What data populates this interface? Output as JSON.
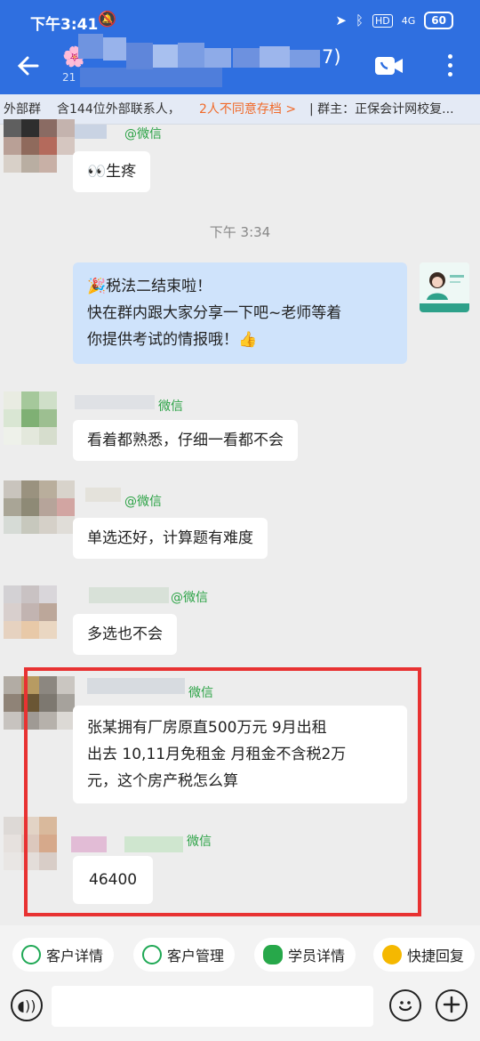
{
  "status": {
    "time": "下午3:41",
    "battery": "60",
    "network": "4G"
  },
  "header": {
    "title_suffix": "7)",
    "subtitle_prefix": "21"
  },
  "infobar": {
    "prefix": "外部群",
    "contacts": "含144位外部联系人，",
    "warning": "2人不同意存档 >",
    "owner": "| 群主：正保会计网校复..."
  },
  "messages": [
    {
      "sender": "@微信",
      "text": "👀生疼"
    },
    {
      "timestamp": "下午 3:34"
    },
    {
      "line1": "🎉税法二结束啦！",
      "line2": "快在群内跟大家分享一下吧~老师等着",
      "line3": "你提供考试的情报哦！👍"
    },
    {
      "sender": "微信",
      "text": "看着都熟悉，仔细一看都不会"
    },
    {
      "sender": "@微信",
      "text": "单选还好，计算题有难度"
    },
    {
      "sender": "@微信",
      "text": "多选也不会"
    },
    {
      "sender": "微信",
      "line1": "张某拥有厂房原直500万元 9月出租",
      "line2": "出去 10,11月免租金 月租金不含税2万",
      "line3": "元，这个房产税怎么算"
    },
    {
      "sender": "微信",
      "text": "46400"
    }
  ],
  "quick_actions": [
    {
      "label": "客户详情",
      "icon": "customer-detail-icon",
      "color": "#1fa855"
    },
    {
      "label": "客户管理",
      "icon": "customer-manage-icon",
      "color": "#1fa855"
    },
    {
      "label": "学员详情",
      "icon": "student-icon",
      "color": "#27a84a"
    },
    {
      "label": "快捷回复",
      "icon": "quick-reply-icon",
      "color": "#f5b800"
    }
  ],
  "colors": {
    "accent": "#2f6fe0",
    "warning": "#f06a2a",
    "highlight": "#e83232",
    "my_bubble": "#cfe3fb"
  }
}
